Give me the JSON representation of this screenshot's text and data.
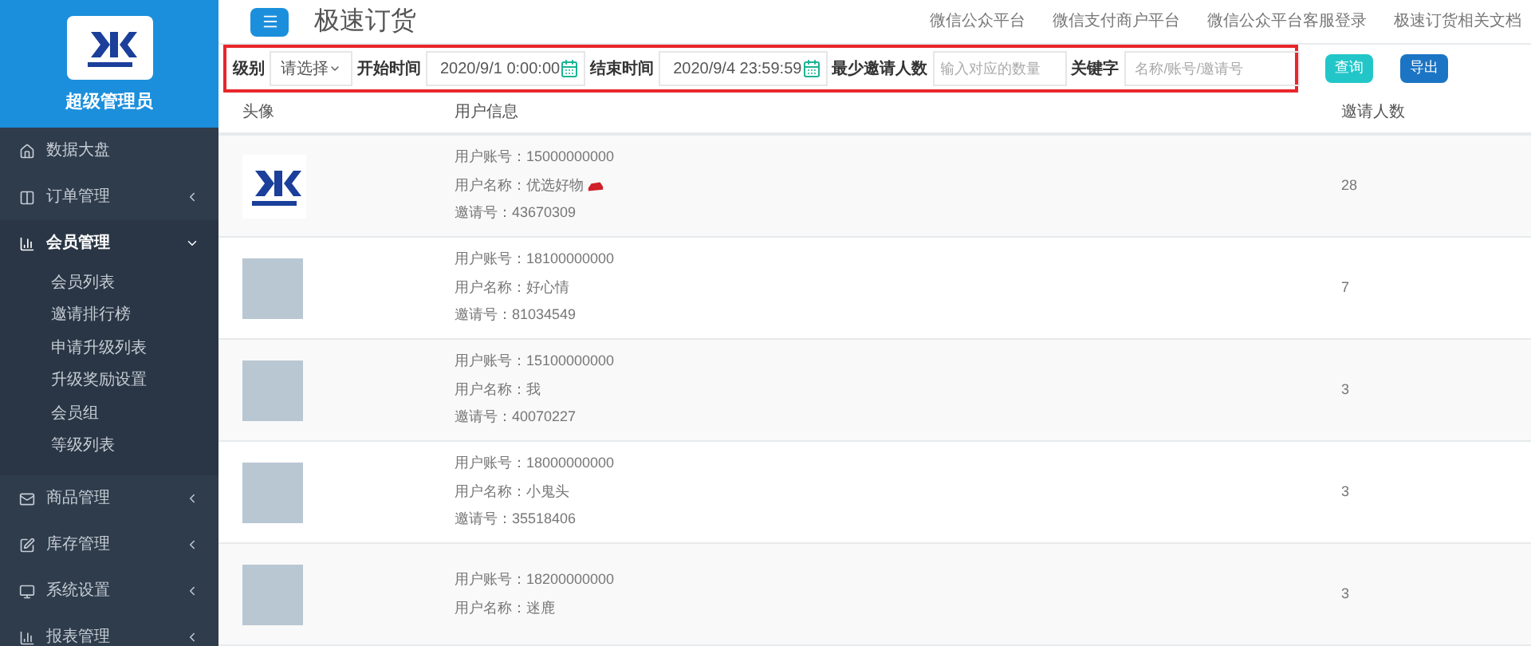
{
  "sidebar": {
    "role": "超级管理员",
    "items": [
      {
        "label": "数据大盘",
        "expandable": false,
        "expanded": false
      },
      {
        "label": "订单管理",
        "expandable": true,
        "expanded": false
      },
      {
        "label": "会员管理",
        "expandable": true,
        "expanded": true,
        "children": [
          {
            "label": "会员列表"
          },
          {
            "label": "邀请排行榜"
          },
          {
            "label": "申请升级列表"
          },
          {
            "label": "升级奖励设置"
          },
          {
            "label": "会员组"
          },
          {
            "label": "等级列表"
          }
        ]
      },
      {
        "label": "商品管理",
        "expandable": true,
        "expanded": false
      },
      {
        "label": "库存管理",
        "expandable": true,
        "expanded": false
      },
      {
        "label": "系统设置",
        "expandable": true,
        "expanded": false
      },
      {
        "label": "报表管理",
        "expandable": true,
        "expanded": false
      }
    ]
  },
  "header": {
    "title": "极速订货",
    "links": [
      "微信公众平台",
      "微信支付商户平台",
      "微信公众平台客服登录",
      "极速订货相关文档"
    ]
  },
  "filters": {
    "level": {
      "label": "级别",
      "value": "请选择"
    },
    "start": {
      "label": "开始时间",
      "value": "2020/9/1 0:00:00"
    },
    "end": {
      "label": "结束时间",
      "value": "2020/9/4 23:59:59"
    },
    "min_invites": {
      "label": "最少邀请人数",
      "placeholder": "输入对应的数量"
    },
    "keyword": {
      "label": "关键字",
      "placeholder": "名称/账号/邀请号"
    },
    "buttons": [
      {
        "kind": "search",
        "label": "查询"
      },
      {
        "kind": "export",
        "label": "导出"
      }
    ]
  },
  "table": {
    "columns": [
      "头像",
      "用户信息",
      "邀请人数"
    ],
    "rows": [
      {
        "kind": "logo",
        "lines": [
          "用户账号：15000000000",
          "用户名称：优选好物",
          "邀请号：43670309"
        ],
        "badge": true,
        "invites": "28"
      },
      {
        "kind": "photo",
        "lines": [
          "用户账号：18100000000",
          "用户名称：好心情",
          "邀请号：81034549"
        ],
        "badge": false,
        "invites": "7"
      },
      {
        "kind": "photo",
        "lines": [
          "用户账号：15100000000",
          "用户名称：我",
          "邀请号：40070227"
        ],
        "badge": false,
        "invites": "3"
      },
      {
        "kind": "photo",
        "lines": [
          "用户账号：18000000000",
          "用户名称：小鬼头",
          "邀请号：35518406"
        ],
        "badge": false,
        "invites": "3"
      },
      {
        "kind": "photo",
        "lines": [
          "用户账号：18200000000",
          "用户名称：迷鹿"
        ],
        "badge": false,
        "invites": "3"
      }
    ]
  }
}
